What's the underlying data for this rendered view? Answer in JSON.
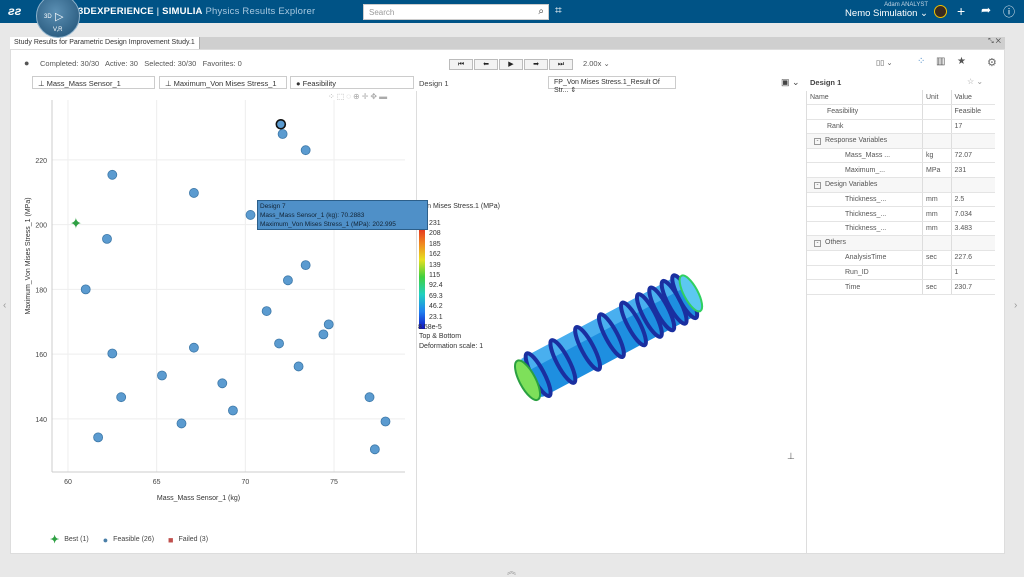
{
  "header": {
    "brand_bold": "3DEXPERIENCE",
    "brand_sep": " | ",
    "brand_simulia": "SIMULIA",
    "app_name": "Physics Results Explorer",
    "search_placeholder": "Search",
    "user_name": "Adam ANALYST",
    "workspace": "Nemo Simulation",
    "compass_labels": [
      "3D",
      "V,R"
    ]
  },
  "tab": {
    "title": "Study Results for Parametric Design Improvement Study.1"
  },
  "toolbar": {
    "status": "Completed: 30/30   Active: 30   Selected: 30/30   Favorites: 0",
    "speed": "2.00x"
  },
  "fields": {
    "x": "Mass_Mass Sensor_1",
    "y": "Maximum_Von Mises Stress_1",
    "color": "Feasibility",
    "design": "Design 1",
    "result": "FP_Von Mises Stress.1_Result Of Str..."
  },
  "tooltip": {
    "title": "Design 7",
    "line1": "Mass_Mass Sensor_1 (kg): 70.2883",
    "line2": "Maximum_Von Mises Stress_1 (MPa): 202.995"
  },
  "legend": {
    "best": "Best (1)",
    "feasible": "Feasible (26)",
    "failed": "Failed (3)"
  },
  "colors": {
    "best": "#2ea043",
    "feasible": "#5b9bd0",
    "failed": "#c0504d",
    "topbar": "#005386"
  },
  "chart_data": {
    "type": "scatter",
    "xlabel": "Mass_Mass Sensor_1 (kg)",
    "ylabel": "Maximum_Von Mises Stress_1 (MPa)",
    "xlim": [
      59.1,
      79.0
    ],
    "ylim": [
      123.6,
      238.5
    ],
    "xticks": [
      60,
      65,
      70,
      75
    ],
    "yticks": [
      140,
      160,
      180,
      200,
      220
    ],
    "grid": true,
    "series": [
      {
        "name": "Best (1)",
        "points": [
          [
            60.45,
            200.3
          ]
        ]
      },
      {
        "name": "Feasible (26)",
        "points": [
          [
            62.5,
            215.4
          ],
          [
            67.1,
            209.8
          ],
          [
            72.0,
            231
          ],
          [
            72.1,
            228
          ],
          [
            73.4,
            223
          ],
          [
            70.29,
            203
          ],
          [
            62.2,
            195.6
          ],
          [
            61.0,
            180
          ],
          [
            73.4,
            187.5
          ],
          [
            72.4,
            182.8
          ],
          [
            71.2,
            173.3
          ],
          [
            74.7,
            169.2
          ],
          [
            74.4,
            166.1
          ],
          [
            71.9,
            163.3
          ],
          [
            67.1,
            162.0
          ],
          [
            62.5,
            160.2
          ],
          [
            73.0,
            156.2
          ],
          [
            65.3,
            153.4
          ],
          [
            68.7,
            151
          ],
          [
            63.0,
            146.7
          ],
          [
            77.0,
            146.7
          ],
          [
            69.3,
            142.6
          ],
          [
            66.4,
            138.6
          ],
          [
            77.9,
            139.2
          ],
          [
            61.7,
            134.3
          ],
          [
            77.3,
            130.6
          ]
        ]
      },
      {
        "name": "Failed (3)",
        "points": []
      }
    ]
  },
  "colorbar": {
    "title": "Von Mises Stress.1 (MPa)",
    "labels": [
      "231",
      "208",
      "185",
      "162",
      "139",
      "115",
      "92.4",
      "69.3",
      "46.2",
      "23.1",
      "8.58e-5"
    ],
    "surface": "Top & Bottom",
    "deformation": "Deformation scale: 1"
  },
  "details": {
    "title": "Design 1",
    "headers": [
      "Name",
      "Unit",
      "Value"
    ],
    "rows": [
      {
        "name": "Feasibility",
        "unit": "",
        "value": "Feasible",
        "level": 1
      },
      {
        "name": "Rank",
        "unit": "",
        "value": "17",
        "level": 1
      },
      {
        "name": "Response Variables",
        "unit": "",
        "value": "",
        "level": 0
      },
      {
        "name": "Mass_Mass ...",
        "unit": "kg",
        "value": "72.07",
        "level": 2
      },
      {
        "name": "Maximum_...",
        "unit": "MPa",
        "value": "231",
        "level": 2
      },
      {
        "name": "Design Variables",
        "unit": "",
        "value": "",
        "level": 0
      },
      {
        "name": "Thickness_...",
        "unit": "mm",
        "value": "2.5",
        "level": 2
      },
      {
        "name": "Thickness_...",
        "unit": "mm",
        "value": "7.034",
        "level": 2
      },
      {
        "name": "Thickness_...",
        "unit": "mm",
        "value": "3.483",
        "level": 2
      },
      {
        "name": "Others",
        "unit": "",
        "value": "",
        "level": 0
      },
      {
        "name": "AnalysisTime",
        "unit": "sec",
        "value": "227.6",
        "level": 2
      },
      {
        "name": "Run_ID",
        "unit": "",
        "value": "1",
        "level": 2
      },
      {
        "name": "Time",
        "unit": "sec",
        "value": "230.7",
        "level": 2
      }
    ]
  }
}
